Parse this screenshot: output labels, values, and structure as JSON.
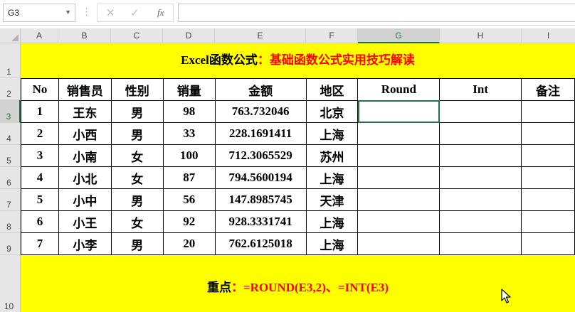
{
  "formula_bar": {
    "name_box": "G3",
    "separator": "⋮",
    "cancel_icon": "✕",
    "enter_icon": "✓",
    "function_icon": "fx",
    "formula_value": ""
  },
  "columns": [
    "A",
    "B",
    "C",
    "D",
    "E",
    "F",
    "G",
    "H",
    "I"
  ],
  "rows": [
    "1",
    "2",
    "3",
    "4",
    "5",
    "6",
    "7",
    "8",
    "9",
    "10"
  ],
  "title": {
    "part1": "Excel函数公式",
    "part2": "：基础函数公式实用技巧解读"
  },
  "table": {
    "headers": [
      "No",
      "销售员",
      "性别",
      "销量",
      "金额",
      "地区",
      "Round",
      "Int",
      "备注"
    ],
    "rows": [
      [
        "1",
        "王东",
        "男",
        "98",
        "763.732046",
        "北京",
        "",
        "",
        ""
      ],
      [
        "2",
        "小西",
        "男",
        "33",
        "228.1691411",
        "上海",
        "",
        "",
        ""
      ],
      [
        "3",
        "小南",
        "女",
        "100",
        "712.3065529",
        "苏州",
        "",
        "",
        ""
      ],
      [
        "4",
        "小北",
        "女",
        "87",
        "794.5600194",
        "上海",
        "",
        "",
        ""
      ],
      [
        "5",
        "小中",
        "男",
        "56",
        "147.8985745",
        "天津",
        "",
        "",
        ""
      ],
      [
        "6",
        "小王",
        "女",
        "92",
        "928.3331741",
        "上海",
        "",
        "",
        ""
      ],
      [
        "7",
        "小李",
        "男",
        "20",
        "762.6125018",
        "上海",
        "",
        "",
        ""
      ]
    ]
  },
  "note": {
    "part1": "重点",
    "part2": "：=ROUND(E3,2)、=INT(E3)"
  },
  "colors": {
    "highlight": "#ffff00",
    "accent_text": "#ff0000",
    "selection": "#217346"
  }
}
